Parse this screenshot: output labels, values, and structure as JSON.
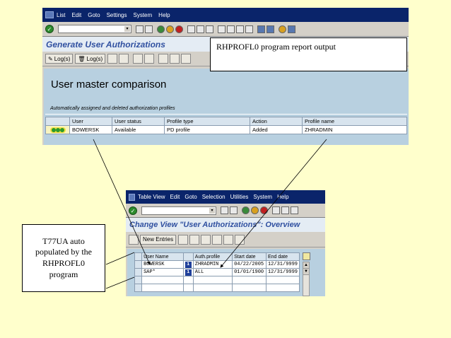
{
  "top_window": {
    "menu": [
      "List",
      "Edit",
      "Goto",
      "Settings",
      "System",
      "Help"
    ],
    "title": "Generate User Authorizations",
    "app_buttons": [
      "Log(s)",
      "Log(s)"
    ],
    "heading": "User master comparison",
    "note": "Automatically assigned and deleted authorization profiles",
    "table": {
      "headers": [
        "User",
        "User status",
        "Profile type",
        "Action",
        "Profile name"
      ],
      "rows": [
        {
          "user": "BOWERSK",
          "status": "Available",
          "profile_type": "PD profile",
          "action": "Added",
          "profile_name": "ZHRADMIN"
        }
      ]
    }
  },
  "callout_top": "RHPROFL0 program report output",
  "bottom_window": {
    "menu": [
      "Table View",
      "Edit",
      "Goto",
      "Selection",
      "Utilities",
      "System",
      "Help"
    ],
    "title": "Change View \"User Authorizations\": Overview",
    "new_entries": "New Entries",
    "table": {
      "headers": [
        "User Name",
        "Auth.profile",
        "Start date",
        "End date"
      ],
      "rows": [
        {
          "user": "BOWERSK",
          "profile": "ZHRADMIN",
          "start": "04/22/2005",
          "end": "12/31/9999"
        },
        {
          "user": "SAP*",
          "profile": "ALL",
          "start": "01/01/1900",
          "end": "12/31/9999"
        }
      ],
      "info_glyph": "i"
    }
  },
  "callout_left": [
    "T77UA auto",
    "populated by the",
    "RHPROFL0",
    "program"
  ],
  "colors": {
    "background": "#ffffcc",
    "menubar": "#0a246a",
    "title_text": "#3050a0",
    "content_area": "#b8d0e0"
  },
  "icons": {
    "ok": "check-icon",
    "info": "info-icon"
  }
}
